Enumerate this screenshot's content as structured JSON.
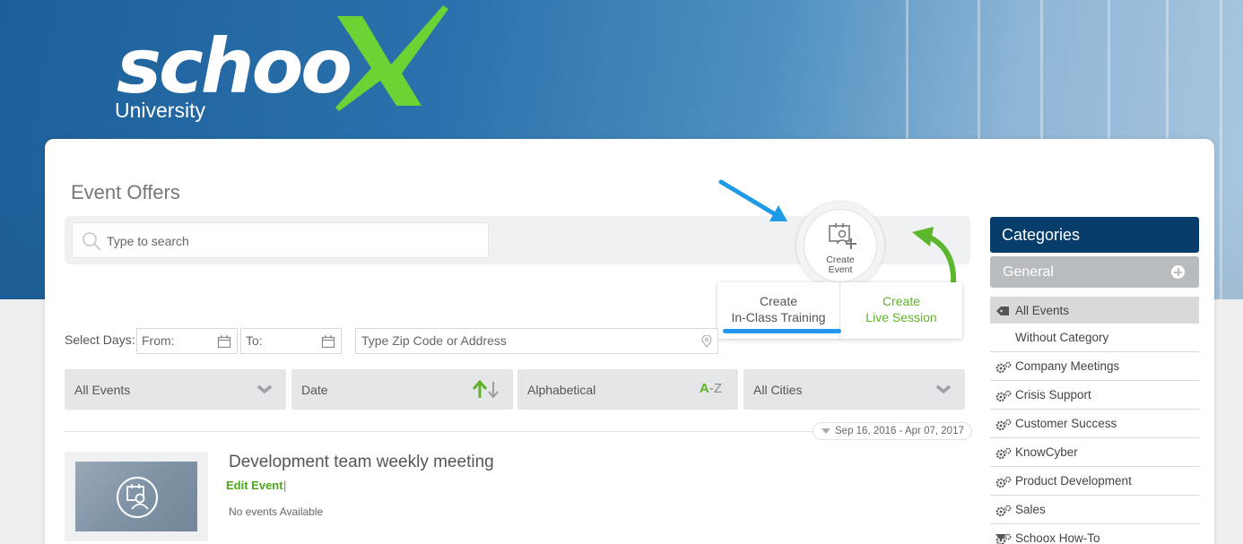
{
  "brand": {
    "logo_word": "schoo",
    "logo_x": "X",
    "logo_sub": "University",
    "accent_green": "#62b22b",
    "header_navy": "#063d6b"
  },
  "page": {
    "title": "Event Offers"
  },
  "search": {
    "placeholder": "Type to search"
  },
  "create_event": {
    "label_line1": "Create",
    "label_line2": "Event",
    "options": [
      {
        "line1": "Create",
        "line2": "In-Class Training"
      },
      {
        "line1": "Create",
        "line2": "Live Session"
      }
    ]
  },
  "filters": {
    "select_days_label": "Select Days:",
    "from_placeholder": "From:",
    "to_placeholder": "To:",
    "zip_placeholder": "Type Zip Code or Address",
    "dropdowns": [
      {
        "label": "All Events",
        "icon": "chevron-down-icon"
      },
      {
        "label": "Date",
        "icon": "sort-arrows-icon"
      },
      {
        "label": "Alphabetical",
        "icon_a": "A",
        "icon_dash": "-",
        "icon_z": "Z"
      },
      {
        "label": "All Cities",
        "icon": "chevron-down-icon"
      }
    ],
    "date_range": "Sep 16, 2016 - Apr 07, 2017"
  },
  "events": [
    {
      "title": "Development team weekly meeting",
      "edit_label": "Edit Event",
      "separator": "|",
      "status": "No events Available"
    }
  ],
  "categories": {
    "header": "Categories",
    "general": "General",
    "items": [
      {
        "label": "All Events",
        "icon": "tag-icon",
        "active": true
      },
      {
        "label": "Without Category",
        "icon": "",
        "active": false
      },
      {
        "label": "Company Meetings",
        "icon": "gears-icon",
        "active": false
      },
      {
        "label": "Crisis Support",
        "icon": "gears-icon",
        "active": false
      },
      {
        "label": "Customer Success",
        "icon": "gears-icon",
        "active": false
      },
      {
        "label": "KnowCyber",
        "icon": "gears-icon",
        "active": false
      },
      {
        "label": "Product Development",
        "icon": "gears-icon",
        "active": false
      },
      {
        "label": "Sales",
        "icon": "gears-icon",
        "active": false
      },
      {
        "label": "Schoox How-To",
        "icon": "gears-icon",
        "active": false
      }
    ]
  }
}
